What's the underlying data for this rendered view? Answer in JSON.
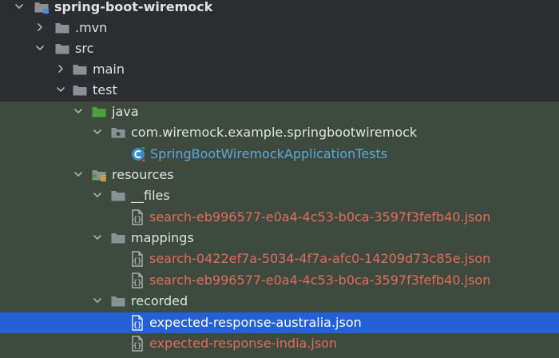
{
  "tree": {
    "root": "spring-boot-wiremock",
    "mvn": ".mvn",
    "src": "src",
    "main": "main",
    "test": "test",
    "java": "java",
    "package": "com.wiremock.example.springbootwiremock",
    "test_class": "SpringBootWiremockApplicationTests",
    "resources": "resources",
    "files_dir": "__files",
    "files_json": "search-eb996577-e0a4-4c53-b0ca-3597f3fefb40.json",
    "mappings_dir": "mappings",
    "mapping_1": "search-0422ef7a-5034-4f7a-afc0-14209d73c85e.json",
    "mapping_2": "search-eb996577-e0a4-4c53-b0ca-3597f3fefb40.json",
    "recorded_dir": "recorded",
    "recorded_1": "expected-response-australia.json",
    "recorded_2": "expected-response-india.json"
  },
  "icons": {
    "root": "module-folder-icon",
    "folder": "folder-icon",
    "source_root": "test-source-root-icon",
    "package": "package-icon",
    "test_class": "junit-class-icon",
    "resources": "test-resources-root-icon",
    "json": "json-file-icon"
  },
  "colors": {
    "background": "#2b2d30",
    "test_region": "#3e4a3d",
    "selection": "#2461d8",
    "text": "#dfe1e5",
    "untracked_file": "#e06c5b",
    "modified_file": "#5da7dc"
  },
  "selected_item": "expected-response-australia.json"
}
